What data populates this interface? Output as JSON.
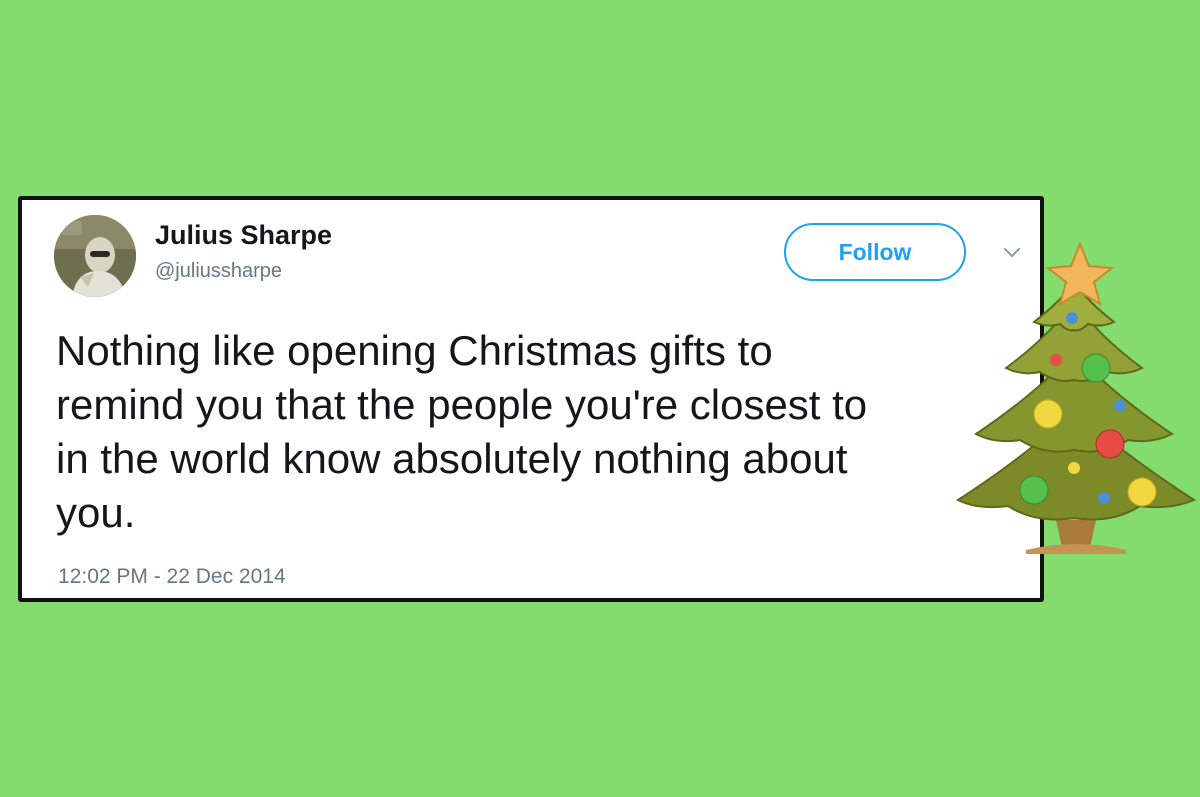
{
  "tweet": {
    "display_name": "Julius Sharpe",
    "handle": "@juliussharpe",
    "follow_label": "Follow",
    "text_lines": [
      "Nothing like opening Christmas gifts to",
      "remind you that the people you're closest to",
      "in the world know absolutely nothing about",
      "you."
    ],
    "timestamp": "12:02 PM - 22 Dec 2014"
  },
  "decoration": {
    "icon": "christmas-tree-emoji"
  },
  "colors": {
    "background": "#84dc6e",
    "accent": "#1da1f2",
    "secondary_text": "#657786",
    "primary_text": "#14171a"
  }
}
